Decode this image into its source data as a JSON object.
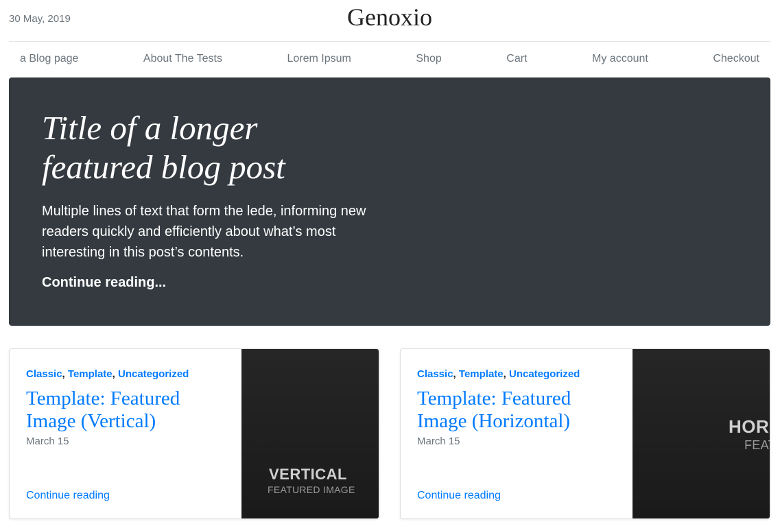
{
  "header": {
    "date": "30 May, 2019",
    "site_title": "Genoxio"
  },
  "nav": {
    "items": [
      {
        "label": "a Blog page"
      },
      {
        "label": "About The Tests"
      },
      {
        "label": "Lorem Ipsum"
      },
      {
        "label": "Shop"
      },
      {
        "label": "Cart"
      },
      {
        "label": "My account"
      },
      {
        "label": "Checkout"
      }
    ]
  },
  "hero": {
    "title": "Title of a longer featured blog post",
    "lede": "Multiple lines of text that form the lede, informing new readers quickly and efficiently about what’s most interesting in this post’s contents.",
    "link": "Continue reading..."
  },
  "cards": [
    {
      "categories": [
        "Classic",
        "Template",
        "Uncategorized"
      ],
      "title": "Template: Featured Image (Vertical)",
      "date": "March 15",
      "link": "Continue reading",
      "thumb_big": "VERTICAL",
      "thumb_small": "FEATURED IMAGE"
    },
    {
      "categories": [
        "Classic",
        "Template",
        "Uncategorized"
      ],
      "title": "Template: Featured Image (Horizontal)",
      "date": "March 15",
      "link": "Continue reading",
      "thumb_big": "HOR",
      "thumb_small": "FEAT"
    }
  ],
  "colors": {
    "link": "#007bff",
    "hero_bg": "#343a40",
    "muted": "#6c757d"
  }
}
